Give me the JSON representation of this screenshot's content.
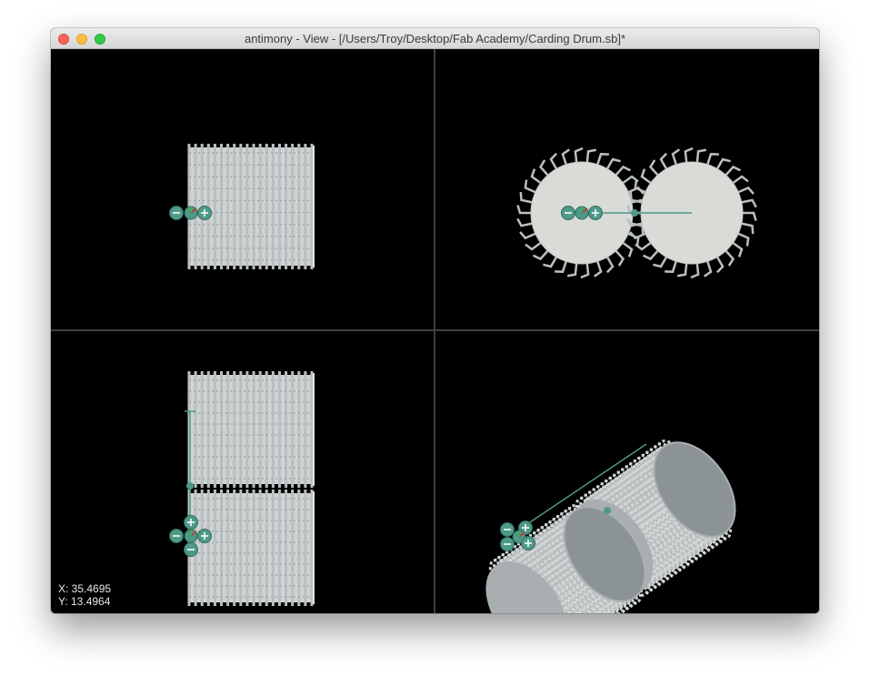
{
  "window": {
    "title": "antimony - View - [/Users/Troy/Desktop/Fab Academy/Carding Drum.sb]*",
    "buttons": [
      "close",
      "minimize",
      "zoom"
    ]
  },
  "viewports": [
    {
      "id": "top-left",
      "content": "front view of carding drum"
    },
    {
      "id": "top-right",
      "content": "end view of two drums"
    },
    {
      "id": "bottom-left",
      "content": "side view of two drums"
    },
    {
      "id": "bottom-right",
      "content": "3D view of two drums"
    }
  ],
  "cursor": {
    "x_label": "X: 35.4695",
    "y_label": "Y: 13.4964"
  },
  "colors": {
    "background": "#000000",
    "drum": "#d9dbd6",
    "teeth": "#b9bfc2",
    "drum_shade": "#8c9396",
    "handle": "#4e9a89",
    "divider": "#404040"
  },
  "icons": [
    "minus-icon",
    "plus-icon",
    "axis-handle-icon"
  ]
}
